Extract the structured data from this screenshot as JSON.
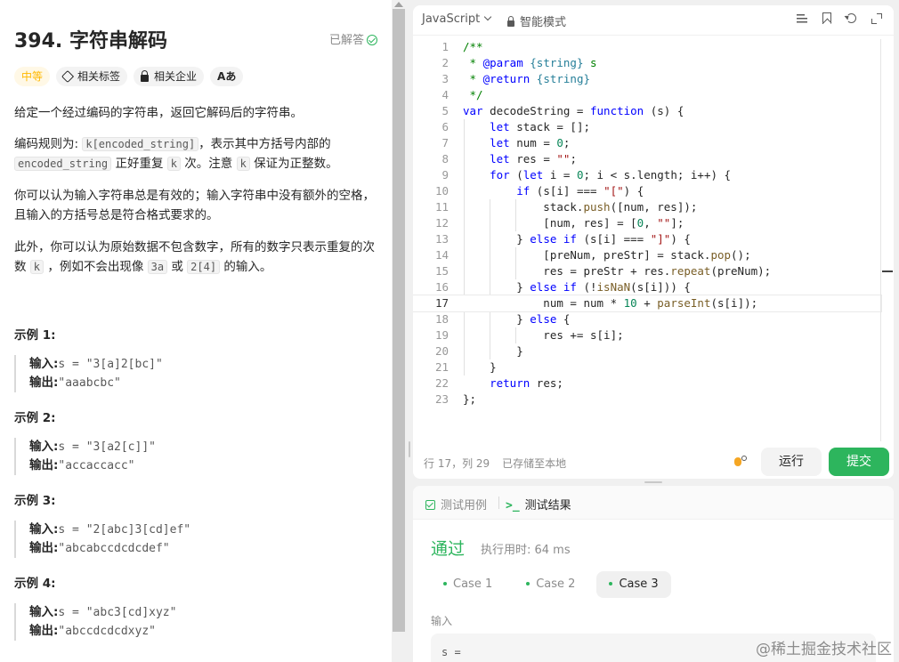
{
  "problem": {
    "title": "394. 字符串解码",
    "solved_label": "已解答",
    "tags": {
      "difficulty": "中等",
      "related_tags": "相关标签",
      "related_companies": "相关企业",
      "font_label": "Aあ"
    },
    "p1": "给定一个经过编码的字符串，返回它解码后的字符串。",
    "p2": {
      "a": "编码规则为: ",
      "code1": "k[encoded_string]",
      "b": "，表示其中方括号内部的",
      "code2": "encoded_string",
      "c": " 正好重复 ",
      "code3": "k",
      "d": " 次。注意 ",
      "code4": "k",
      "e": " 保证为正整数。"
    },
    "p3": "你可以认为输入字符串总是有效的；输入字符串中没有额外的空格，且输入的方括号总是符合格式要求的。",
    "p4": {
      "a": "此外，你可以认为原始数据不包含数字，所有的数字只表示重复的次数 ",
      "code1": "k",
      "b": " ，例如不会出现像 ",
      "code2": "3a",
      "c": " 或 ",
      "code3": "2[4]",
      "d": " 的输入。"
    },
    "examples": [
      {
        "title": "示例 1:",
        "input_label": "输入:",
        "input": "s = \"3[a]2[bc]\"",
        "output_label": "输出:",
        "output": "\"aaabcbc\""
      },
      {
        "title": "示例 2:",
        "input_label": "输入:",
        "input": "s = \"3[a2[c]]\"",
        "output_label": "输出:",
        "output": "\"accaccacc\""
      },
      {
        "title": "示例 3:",
        "input_label": "输入:",
        "input": "s = \"2[abc]3[cd]ef\"",
        "output_label": "输出:",
        "output": "\"abcabccdcdcdef\""
      },
      {
        "title": "示例 4:",
        "input_label": "输入:",
        "input": "s = \"abc3[cd]xyz\"",
        "output_label": "输出:",
        "output": "\"abccdcdcdxyz\""
      }
    ]
  },
  "editor": {
    "language": "JavaScript",
    "mode": "智能模式",
    "active_line": 17,
    "line_numbers": [
      "1",
      "2",
      "3",
      "4",
      "5",
      "6",
      "7",
      "8",
      "9",
      "10",
      "11",
      "12",
      "13",
      "14",
      "15",
      "16",
      "17",
      "18",
      "19",
      "20",
      "21",
      "22",
      "23"
    ],
    "status_position": "行 17，列 29",
    "status_saved": "已存储至本地",
    "run_label": "运行",
    "submit_label": "提交"
  },
  "results": {
    "tab_testcase": "测试用例",
    "tab_result": "测试结果",
    "term_glyph": ">_",
    "status": "通过",
    "runtime": "执行用时: 64 ms",
    "cases": [
      "Case 1",
      "Case 2",
      "Case 3"
    ],
    "active_case": 2,
    "input_label": "输入",
    "input_value": "s ="
  },
  "watermark": "@稀土掘金技术社区",
  "colors": {
    "accent_green": "#2db55d",
    "difficulty_yellow": "#ffb800"
  }
}
